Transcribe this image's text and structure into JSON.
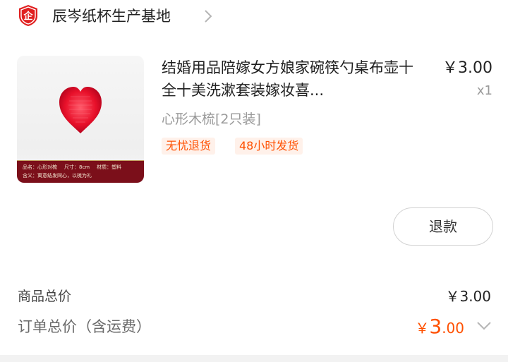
{
  "shop": {
    "logo_icon": "shop-badge-icon",
    "logo_text": "企",
    "name": "辰岑纸杯生产基地"
  },
  "product": {
    "title": "结婚用品陪嫁女方娘家碗筷勺桌布壶十全十美洗漱套装嫁妆喜...",
    "variant": "心形木梳[2只装]",
    "tags": [
      "无忧退货",
      "48小时发货"
    ],
    "price": "￥3.00",
    "quantity": "x1",
    "image": {
      "info_line_1": {
        "name": "品名：心形对梳",
        "size": "尺寸：8cm",
        "material": "材质：塑料"
      },
      "info_line_2": "含义：寓意结发同心，以梳为礼"
    }
  },
  "actions": {
    "refund_label": "退款"
  },
  "summary": {
    "goods_total_label": "商品总价",
    "goods_total_value": "￥3.00",
    "order_total_label": "订单总价（含运费）",
    "order_total_currency": "￥",
    "order_total_int": "3",
    "order_total_dec": ".00"
  },
  "colors": {
    "accent": "#ff5000",
    "shop_logo": "#e02020",
    "tag_bg": "#fff1ea"
  }
}
